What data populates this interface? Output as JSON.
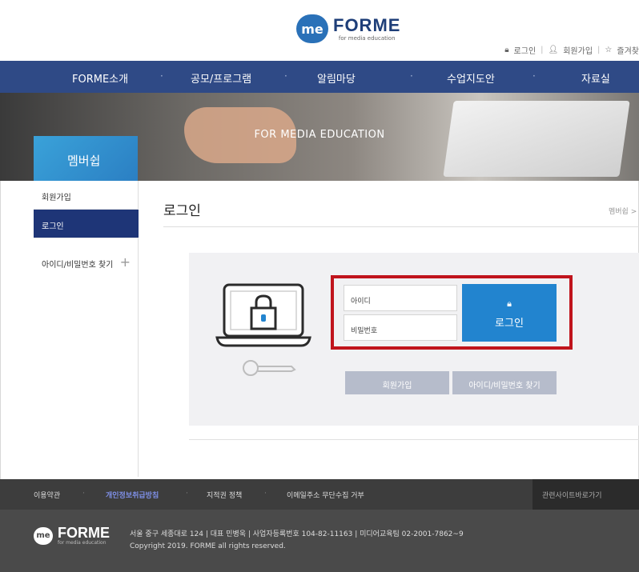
{
  "header": {
    "logo_mark": "me",
    "logo_name": "FORME",
    "logo_sub": "for media education",
    "util": {
      "login": "로그인",
      "join": "회원가입",
      "favorite": "즐겨찾"
    }
  },
  "nav": {
    "items": [
      "FORME소개",
      "공모/프로그램",
      "알림마당",
      "수업지도안",
      "자료실"
    ]
  },
  "banner": {
    "tagline": "FOR MEDIA EDUCATION",
    "section": "멤버쉽"
  },
  "sidebar": {
    "items": [
      "회원가입",
      "로그인",
      "아이디/비밀번호 찾기"
    ],
    "active_index": 1
  },
  "main": {
    "title": "로그인",
    "breadcrumb": "멤버쉽 >",
    "id_placeholder": "아이디",
    "pw_placeholder": "비밀번호",
    "login_button": "로그인",
    "join_button": "회원가입",
    "find_button": "아이디/비밀번호 찾기"
  },
  "footer": {
    "links": [
      "이용약관",
      "개인정보취급방침",
      "지적권 정책",
      "이메일주소 무단수집 거부"
    ],
    "related": "관련사이트바로가기",
    "logo_mark": "me",
    "logo_name": "FORME",
    "logo_sub": "for media education",
    "address": "서울 중구 세종대로 124 | 대표 민병욱 | 사업자등록번호 104-82-11163 | 미디어교육팀 02-2001-7862~9",
    "copyright": "Copyright 2019. FORME all rights reserved."
  },
  "colors": {
    "nav_bg": "#2f4a86",
    "accent": "#2284cf",
    "highlight": "#c0141c",
    "active_sidebar": "#1e3577"
  }
}
